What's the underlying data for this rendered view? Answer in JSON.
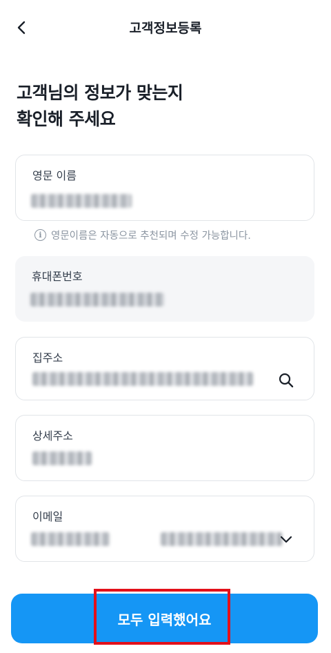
{
  "header": {
    "title": "고객정보등록",
    "back_icon": "chevron-left-icon"
  },
  "heading": {
    "line1": "고객님의 정보가 맞는지",
    "line2": "확인해 주세요"
  },
  "fields": {
    "english_name": {
      "label": "영문 이름"
    },
    "phone": {
      "label": "휴대폰번호"
    },
    "address": {
      "label": "집주소",
      "icon": "search-icon"
    },
    "address_detail": {
      "label": "상세주소"
    },
    "email": {
      "label": "이메일",
      "icon": "chevron-down-icon"
    }
  },
  "hint": {
    "icon": "info-icon",
    "text": "영문이름은 자동으로 추천되며 수정 가능합니다."
  },
  "submit": {
    "label": "모두 입력했어요"
  },
  "colors": {
    "primary": "#1596f5",
    "highlight": "#e3101a",
    "readonly_bg": "#f5f6f8",
    "border": "#e1e4e8",
    "hint_text": "#8b95a1"
  }
}
